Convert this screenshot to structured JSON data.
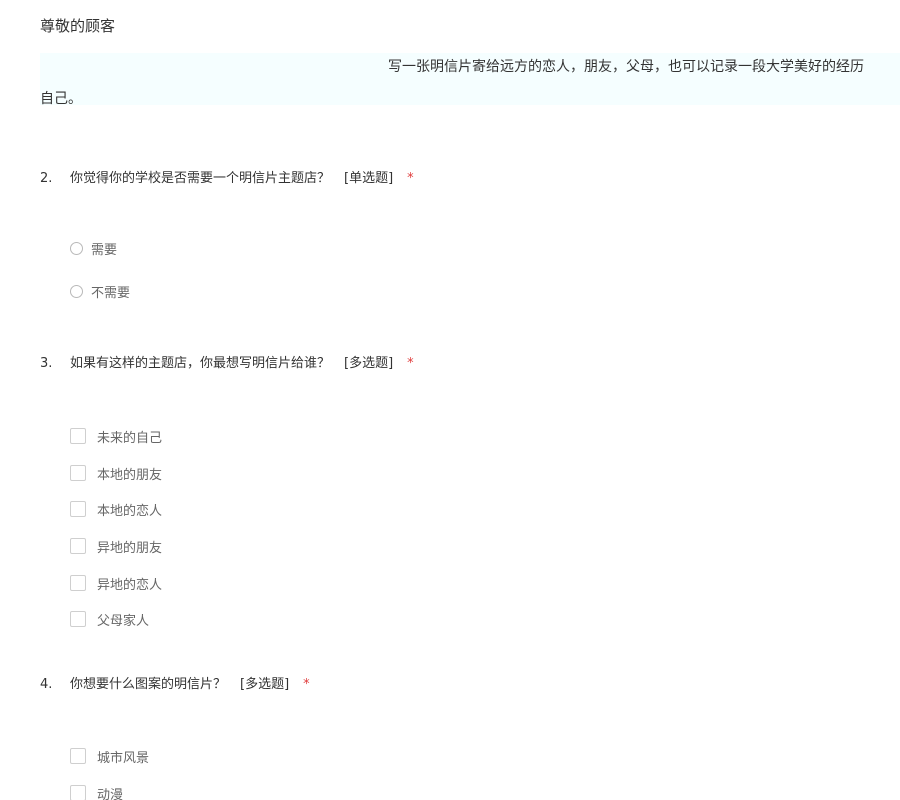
{
  "greeting": "尊敬的顾客",
  "intro": {
    "line1": "写一张明信片寄给远方的恋人，朋友，父母，也可以记录一段大学美好的经历",
    "line2": "自己。"
  },
  "questions": [
    {
      "number": "2.",
      "text": "你觉得你的学校是否需要一个明信片主题店？",
      "type": "[单选题]",
      "required": "*",
      "options": [
        "需要",
        "不需要"
      ]
    },
    {
      "number": "3.",
      "text": "如果有这样的主题店，你最想写明信片给谁？",
      "type": "[多选题]",
      "required": "*",
      "options": [
        "未来的自己",
        "本地的朋友",
        "本地的恋人",
        "异地的朋友",
        "异地的恋人",
        "父母家人"
      ]
    },
    {
      "number": "4.",
      "text": "你想要什么图案的明信片？",
      "type": "[多选题]",
      "required": "*",
      "options": [
        "城市风景",
        "动漫"
      ]
    }
  ],
  "colors": {
    "intro_background": "#f5feff",
    "required_marker": "#e03b3b",
    "option_text": "#666666"
  }
}
